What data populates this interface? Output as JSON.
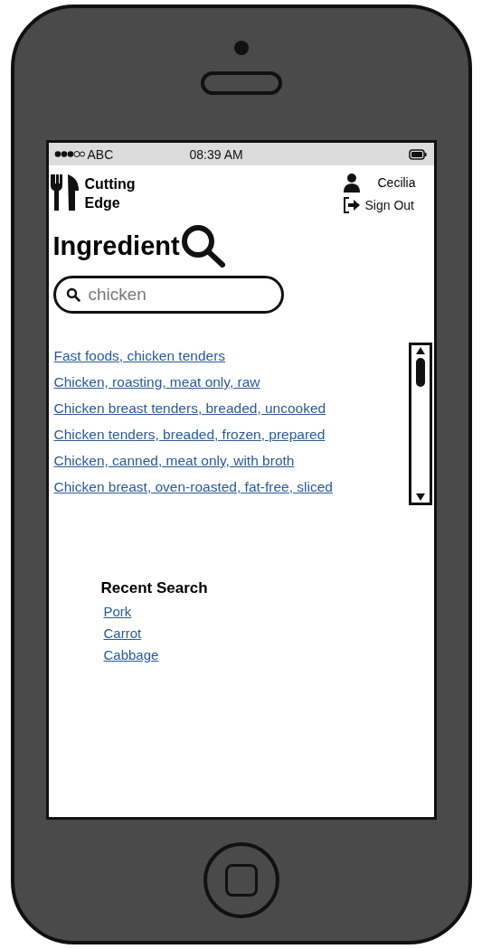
{
  "status_bar": {
    "carrier": "ABC",
    "time": "08:39 AM"
  },
  "header": {
    "logo_text": "Cutting Edge",
    "user_name": "Cecilia",
    "sign_out": "Sign Out"
  },
  "title": "Ingredient",
  "search": {
    "value": "chicken"
  },
  "results": [
    {
      "label": "Fast foods, chicken tenders"
    },
    {
      "label": "Chicken, roasting, meat only, raw"
    },
    {
      "label": "Chicken breast tenders, breaded, uncooked"
    },
    {
      "label": "Chicken tenders, breaded, frozen, prepared"
    },
    {
      "label": "Chicken, canned, meat only, with broth"
    },
    {
      "label": "Chicken breast, oven-roasted, fat-free, sliced"
    }
  ],
  "recent": {
    "heading": "Recent Search",
    "items": [
      {
        "label": "Pork"
      },
      {
        "label": "Carrot"
      },
      {
        "label": "Cabbage"
      }
    ]
  }
}
